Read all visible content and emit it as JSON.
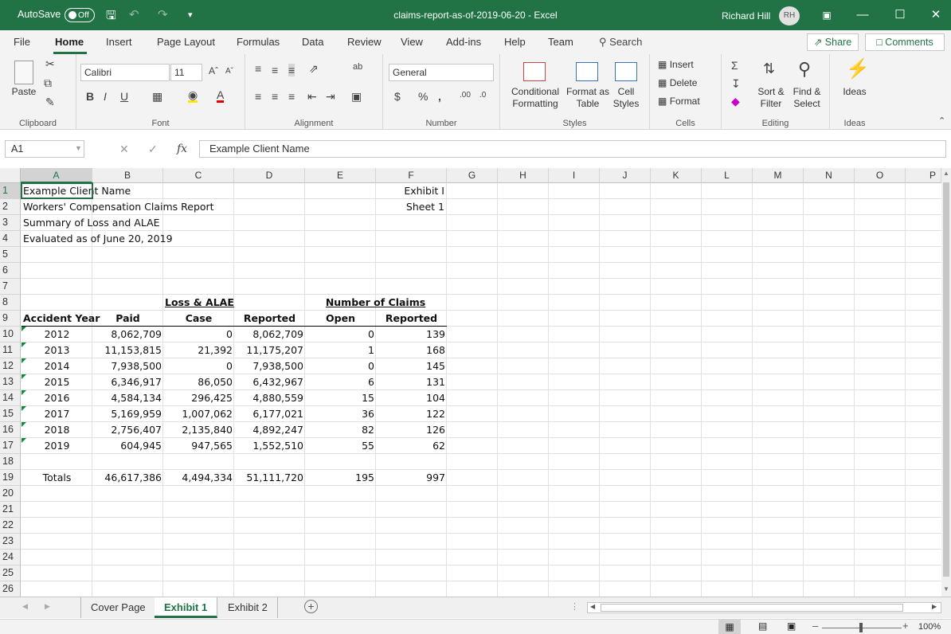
{
  "titlebar": {
    "autosave_label": "AutoSave",
    "autosave_state": "Off",
    "title": "claims-report-as-of-2019-06-20  -  Excel",
    "user_name": "Richard Hill",
    "user_initials": "RH"
  },
  "ribbon_tabs": [
    "File",
    "Home",
    "Insert",
    "Page Layout",
    "Formulas",
    "Data",
    "Review",
    "View",
    "Add-ins",
    "Help",
    "Team"
  ],
  "search_label": "Search",
  "share_label": "Share",
  "comments_label": "Comments",
  "ribbon": {
    "clipboard": {
      "paste": "Paste",
      "label": "Clipboard"
    },
    "font": {
      "name": "Calibri",
      "size": "11",
      "label": "Font"
    },
    "alignment": {
      "label": "Alignment"
    },
    "number": {
      "format": "General",
      "label": "Number"
    },
    "styles": {
      "conditional": "Conditional",
      "conditional2": "Formatting",
      "format_as": "Format as",
      "format_as2": "Table",
      "cell": "Cell",
      "cell2": "Styles",
      "label": "Styles"
    },
    "cells": {
      "insert": "Insert",
      "delete": "Delete",
      "format": "Format",
      "label": "Cells"
    },
    "editing": {
      "sort": "Sort &",
      "sort2": "Filter",
      "find": "Find &",
      "find2": "Select",
      "label": "Editing"
    },
    "ideas": {
      "btn": "Ideas",
      "label": "Ideas"
    }
  },
  "formula_bar": {
    "name_box": "A1",
    "fx": "fx",
    "value": "Example Client Name"
  },
  "columns": [
    "A",
    "B",
    "C",
    "D",
    "E",
    "F",
    "G",
    "H",
    "I",
    "J",
    "K",
    "L",
    "M",
    "N",
    "O",
    "P"
  ],
  "rows": [
    "1",
    "2",
    "3",
    "4",
    "5",
    "6",
    "7",
    "8",
    "9",
    "10",
    "11",
    "12",
    "13",
    "14",
    "15",
    "16",
    "17",
    "18",
    "19",
    "20",
    "21",
    "22",
    "23",
    "24",
    "25",
    "26"
  ],
  "sheet": {
    "a1": "Example Client Name",
    "a2": "Workers' Compensation Claims Report",
    "a3": "Summary of Loss and ALAE",
    "a4": "Evaluated as of June 20, 2019",
    "f1": "Exhibit I",
    "f2": "Sheet 1",
    "loss_header": "Loss & ALAE",
    "claims_header": "Number of Claims",
    "col_headers": [
      "Accident Year",
      "Paid",
      "Case",
      "Reported",
      "Open",
      "Reported"
    ],
    "data_rows": [
      [
        "2012",
        "8,062,709",
        "0",
        "8,062,709",
        "0",
        "139"
      ],
      [
        "2013",
        "11,153,815",
        "21,392",
        "11,175,207",
        "1",
        "168"
      ],
      [
        "2014",
        "7,938,500",
        "0",
        "7,938,500",
        "0",
        "145"
      ],
      [
        "2015",
        "6,346,917",
        "86,050",
        "6,432,967",
        "6",
        "131"
      ],
      [
        "2016",
        "4,584,134",
        "296,425",
        "4,880,559",
        "15",
        "104"
      ],
      [
        "2017",
        "5,169,959",
        "1,007,062",
        "6,177,021",
        "36",
        "122"
      ],
      [
        "2018",
        "2,756,407",
        "2,135,840",
        "4,892,247",
        "82",
        "126"
      ],
      [
        "2019",
        "604,945",
        "947,565",
        "1,552,510",
        "55",
        "62"
      ]
    ],
    "totals": [
      "Totals",
      "46,617,386",
      "4,494,334",
      "51,111,720",
      "195",
      "997"
    ]
  },
  "sheet_tabs": [
    "Cover Page",
    "Exhibit 1",
    "Exhibit 2"
  ],
  "active_sheet": "Exhibit 1",
  "zoom": "100%",
  "colors": {
    "accent": "#217346",
    "error_triangle": "#0b8a3a"
  }
}
